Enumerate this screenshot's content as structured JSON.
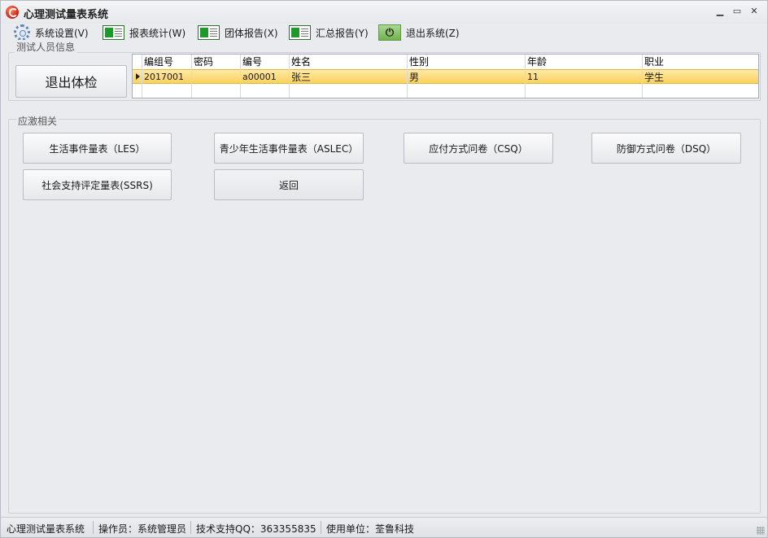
{
  "window": {
    "title": "心理测试量表系统",
    "minimize": "▁",
    "maximize": "▭",
    "close": "✕"
  },
  "menu": [
    {
      "label": "系统设置(V)",
      "icon": "gear-icon"
    },
    {
      "label": "报表统计(W)",
      "icon": "report-icon"
    },
    {
      "label": "团体报告(X)",
      "icon": "report-icon"
    },
    {
      "label": "汇总报告(Y)",
      "icon": "report-icon"
    },
    {
      "label": "退出系统(Z)",
      "icon": "power-icon"
    }
  ],
  "tester_group": {
    "title": "测试人员信息",
    "exit_button": "退出体检"
  },
  "grid": {
    "columns": [
      "编组号",
      "密码",
      "编号",
      "姓名",
      "性别",
      "年龄",
      "职业"
    ],
    "rows": [
      [
        "2017001",
        "",
        "a00001",
        "张三",
        "男",
        "11",
        "学生"
      ]
    ]
  },
  "stress_group": {
    "title": "应激相关",
    "buttons": [
      "生活事件量表（LES）",
      "青少年生活事件量表（ASLEC）",
      "应付方式问卷（CSQ）",
      "防御方式问卷（DSQ）",
      "社会支持评定量表(SSRS)",
      "返回"
    ]
  },
  "status": {
    "app_name": "心理测试量表系统",
    "operator": "操作员：系统管理员",
    "support": "技术支持QQ：363355835",
    "unit": "使用单位：荃鲁科技"
  },
  "colors": {
    "selected_row": "#fcd25e",
    "background": "#e9ebee"
  }
}
